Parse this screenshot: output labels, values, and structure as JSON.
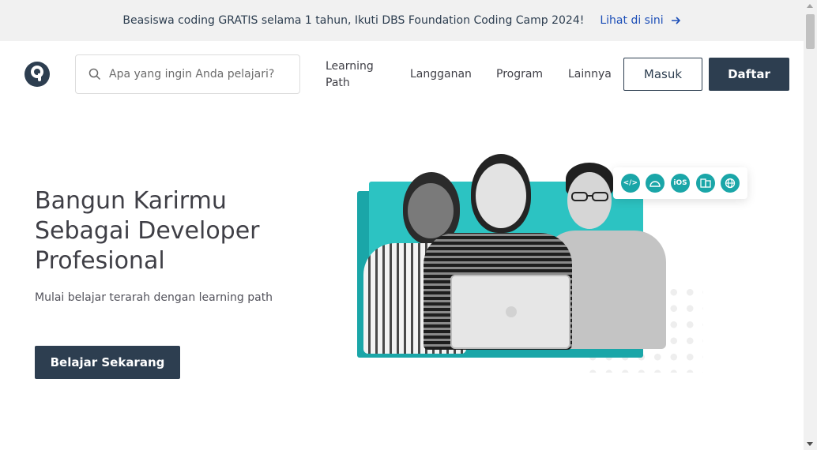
{
  "banner": {
    "message": "Beasiswa coding GRATIS selama 1 tahun, Ikuti DBS Foundation Coding Camp 2024!",
    "link_label": "Lihat di sini",
    "link_icon": "arrow-right-icon"
  },
  "header": {
    "logo_icon": "dicoding-logo",
    "search": {
      "placeholder": "Apa yang ingin Anda pelajari?",
      "value": "",
      "icon": "search-icon"
    },
    "nav": {
      "learning_path": "Learning Path",
      "langganan": "Langganan",
      "program": "Program",
      "lainnya": "Lainnya"
    },
    "masuk_label": "Masuk",
    "daftar_label": "Daftar"
  },
  "hero": {
    "title": "Bangun Karirmu Sebagai Developer Profesional",
    "subtitle": "Mulai belajar terarah dengan learning path",
    "cta_label": "Belajar Sekarang"
  },
  "illustration": {
    "platform_icons": [
      {
        "name": "code-icon",
        "text": "</>"
      },
      {
        "name": "android-icon",
        "text": ""
      },
      {
        "name": "ios-icon",
        "text": "iOS"
      },
      {
        "name": "multiplatform-icon",
        "text": ""
      },
      {
        "name": "web-icon",
        "text": ""
      }
    ]
  },
  "colors": {
    "primary": "#2d3e50",
    "teal": "#2cc3c2",
    "teal_dark": "#1aa6a8",
    "banner_bg": "#f1f1f1",
    "link": "#1d4fb8"
  }
}
